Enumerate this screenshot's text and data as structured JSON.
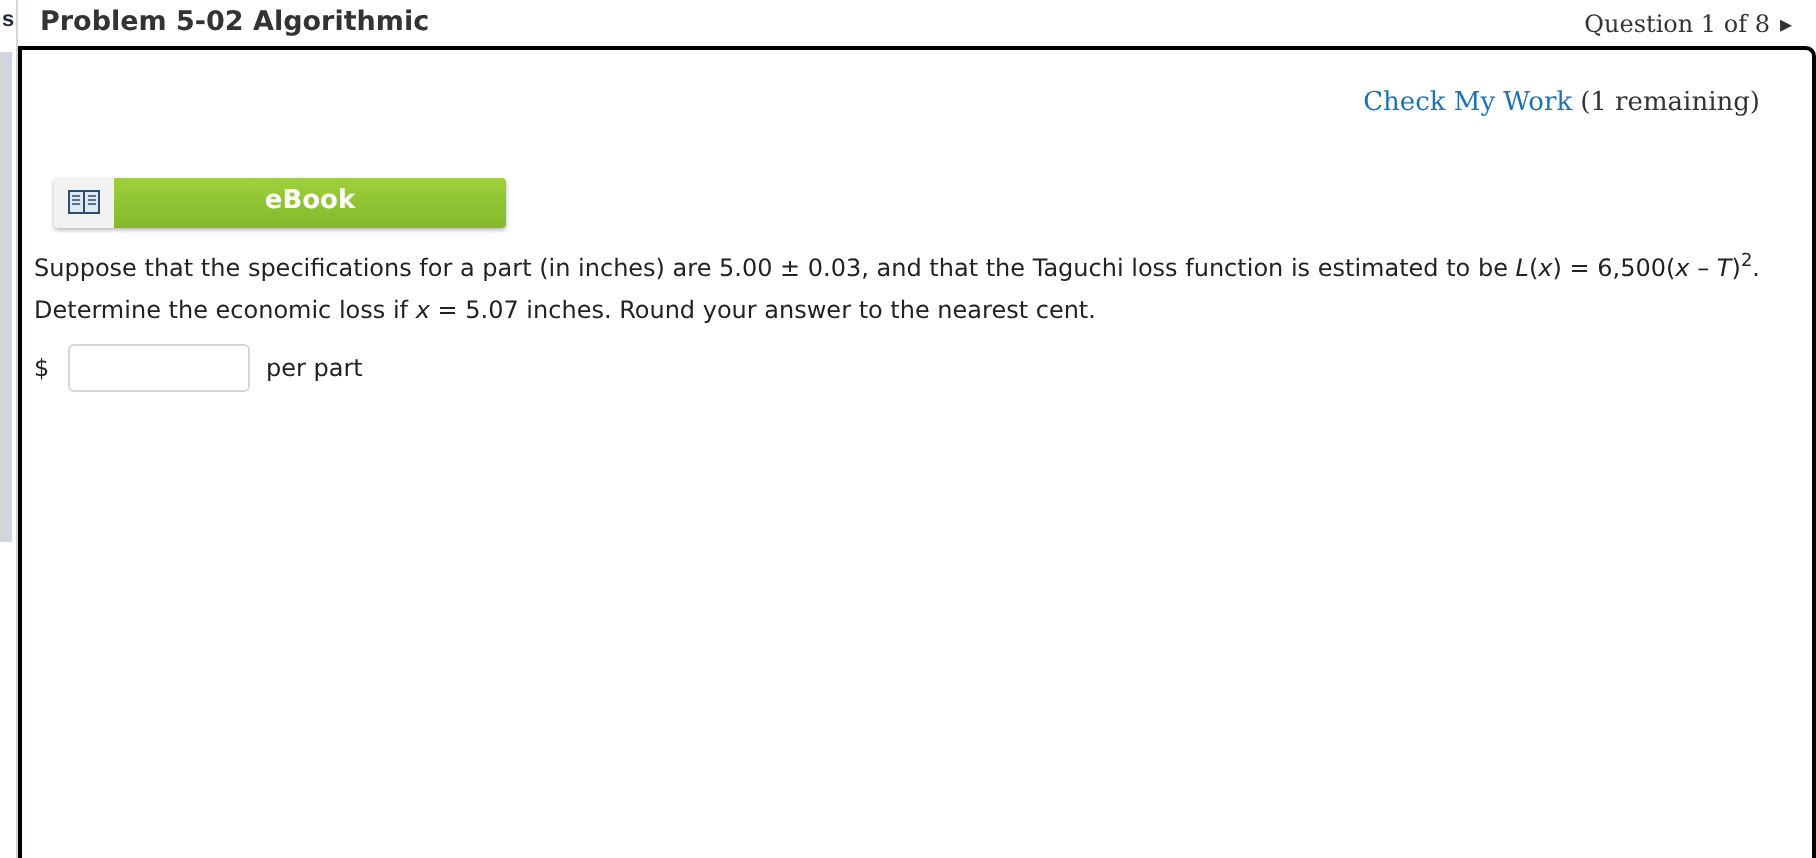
{
  "left_edge_text": "s",
  "header": {
    "title": "Problem 5-02 Algorithmic",
    "question_nav": "Question 1 of 8",
    "next_arrow": "▸"
  },
  "check_my_work": {
    "link": "Check My Work",
    "remaining": "(1 remaining)"
  },
  "ebook_button": {
    "label": "eBook"
  },
  "question": {
    "text": "Suppose that the specifications for a part (in inches) are 5.00 ± 0.03, and that the Taguchi loss function is estimated to be *L*(*x*) = 6,500(*x* – *T*)$^{2}$.",
    "instruction": "Determine the economic loss if *x* = 5.07 inches. Round your answer to the nearest cent."
  },
  "answer": {
    "prefix": "$",
    "suffix": "per part"
  }
}
